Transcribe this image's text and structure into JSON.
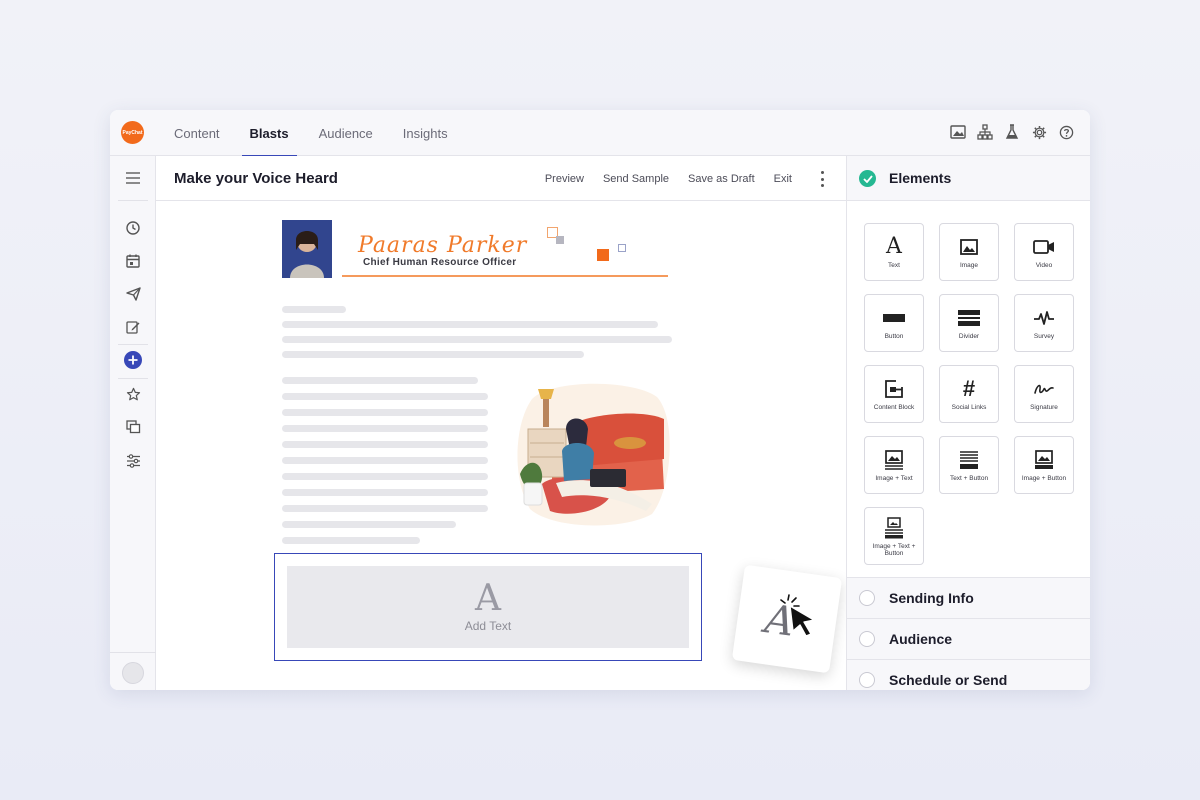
{
  "app": {
    "logo_text": "PayChat"
  },
  "nav": {
    "tabs": [
      {
        "label": "Content",
        "active": false
      },
      {
        "label": "Blasts",
        "active": true
      },
      {
        "label": "Audience",
        "active": false
      },
      {
        "label": "Insights",
        "active": false
      }
    ],
    "icons": [
      "image-icon",
      "org-chart-icon",
      "flask-icon",
      "gear-icon",
      "help-icon"
    ]
  },
  "sidebar": {
    "items": [
      "menu-icon",
      "clock-icon",
      "calendar-icon",
      "send-icon",
      "edit-icon",
      "add-icon",
      "star-icon",
      "copy-icon",
      "sliders-icon"
    ]
  },
  "editor": {
    "title": "Make your Voice Heard",
    "actions": [
      "Preview",
      "Send Sample",
      "Save as Draft",
      "Exit"
    ]
  },
  "email": {
    "signature_name": "Paaras Parker",
    "signature_role": "Chief Human Resource Officer",
    "add_text_label": "Add Text"
  },
  "panel": {
    "title": "Elements",
    "elements": [
      "Text",
      "Image",
      "Video",
      "Button",
      "Divider",
      "Survey",
      "Content Block",
      "Social Links",
      "Signature",
      "Image + Text",
      "Text + Button",
      "Image + Button",
      "Image + Text + Button"
    ],
    "sections": [
      "Sending Info",
      "Audience",
      "Schedule or Send"
    ]
  },
  "colors": {
    "accent": "#3848b8",
    "brand": "#f26a1b",
    "success": "#25b892"
  }
}
